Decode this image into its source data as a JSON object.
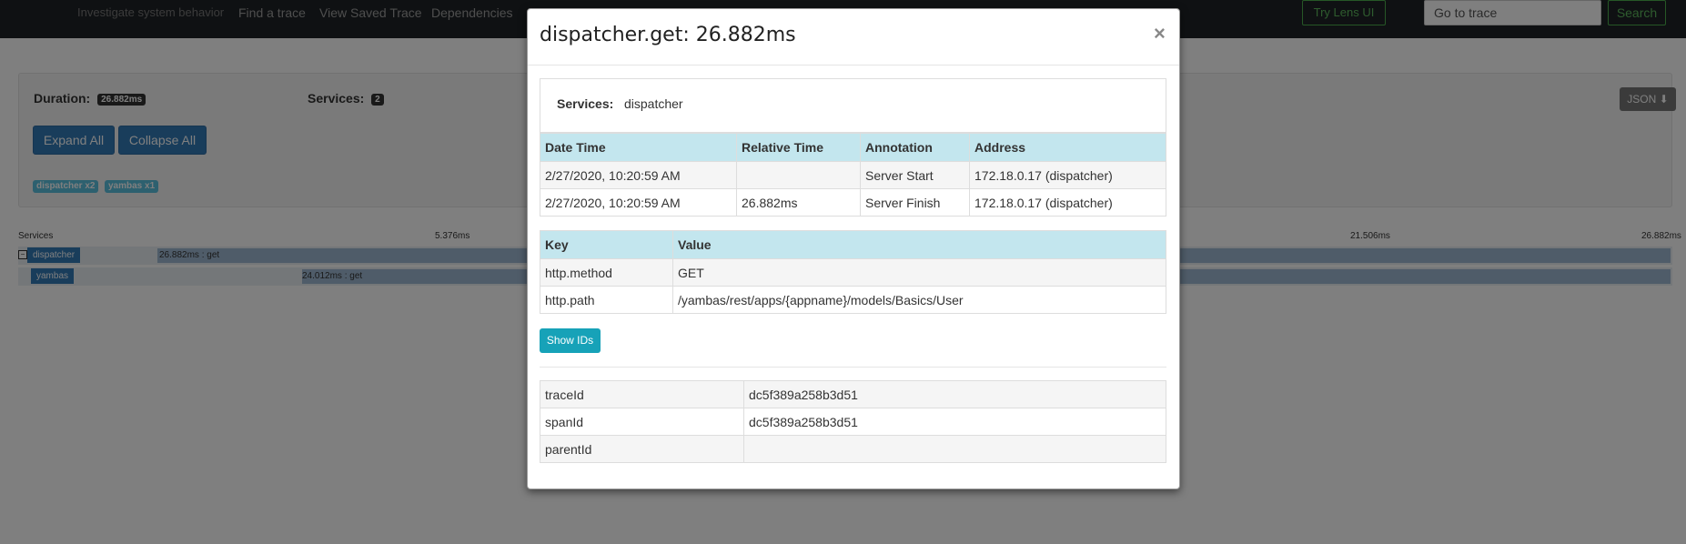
{
  "nav": {
    "items": [
      "Investigate system behavior",
      "Find a trace",
      "View Saved Trace",
      "Dependencies"
    ],
    "lens_button": "Try Lens UI",
    "goto_placeholder": "Go to trace",
    "search_button": "Search"
  },
  "summary": {
    "duration_label": "Duration:",
    "duration_value": "26.882ms",
    "services_label": "Services:",
    "services_value": "2",
    "expand_all": "Expand All",
    "collapse_all": "Collapse All",
    "service_badges": [
      "dispatcher x2",
      "yambas x1"
    ],
    "json_button": "JSON"
  },
  "timeline": {
    "services_header": "Services",
    "ticks": [
      "5.376ms",
      "21.506ms",
      "26.882ms"
    ],
    "rows": [
      {
        "service": "dispatcher",
        "label": "26.882ms : get"
      },
      {
        "service": "yambas",
        "label": "24.012ms : get"
      }
    ]
  },
  "modal": {
    "title": "dispatcher.get: 26.882ms",
    "close": "×",
    "services_label": "Services:",
    "services_value": "dispatcher",
    "annotations_headers": [
      "Date Time",
      "Relative Time",
      "Annotation",
      "Address"
    ],
    "annotations": [
      [
        "2/27/2020, 10:20:59 AM",
        "",
        "Server Start",
        "172.18.0.17 (dispatcher)"
      ],
      [
        "2/27/2020, 10:20:59 AM",
        "26.882ms",
        "Server Finish",
        "172.18.0.17 (dispatcher)"
      ]
    ],
    "tags_headers": [
      "Key",
      "Value"
    ],
    "tags": [
      [
        "http.method",
        "GET"
      ],
      [
        "http.path",
        "/yambas/rest/apps/{appname}/models/Basics/User"
      ]
    ],
    "show_ids": "Show IDs",
    "ids": [
      [
        "traceId",
        "dc5f389a258b3d51"
      ],
      [
        "spanId",
        "dc5f389a258b3d51"
      ],
      [
        "parentId",
        ""
      ]
    ]
  }
}
